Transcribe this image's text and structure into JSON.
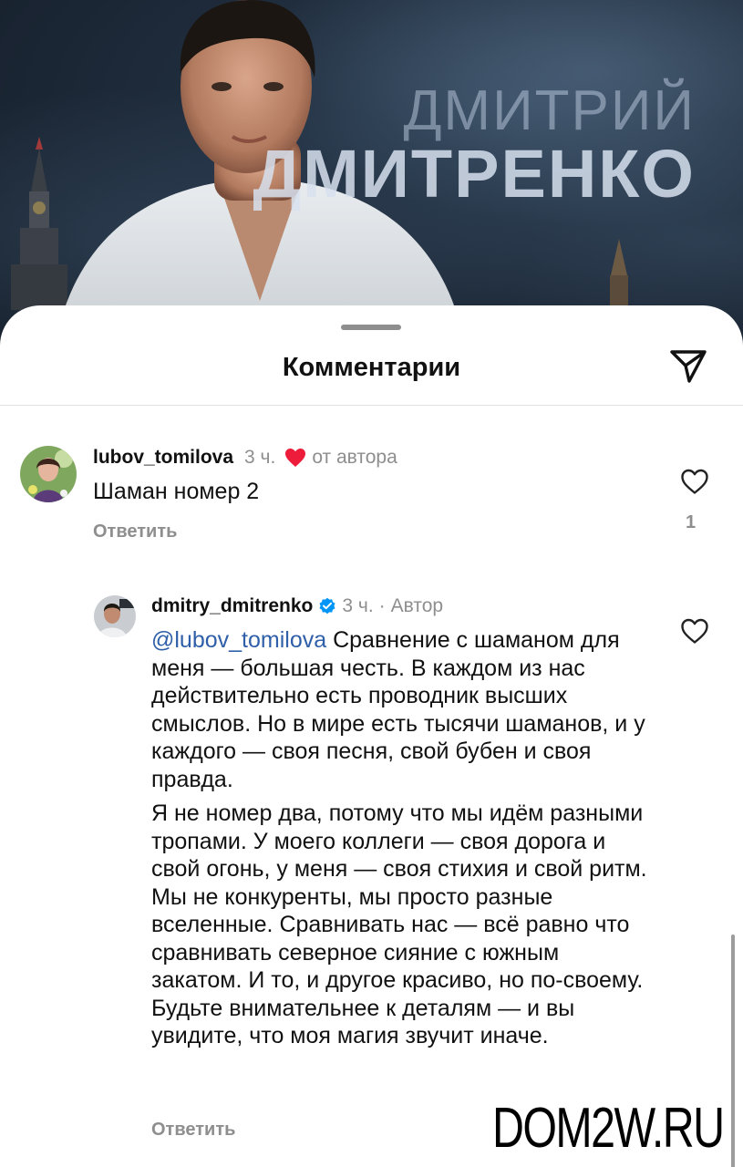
{
  "hero": {
    "title_first": "ДМИТРИЙ",
    "title_last": "ДМИТРЕНКО"
  },
  "sheet": {
    "title": "Комментарии",
    "send_icon": "paper-plane-icon"
  },
  "comments": [
    {
      "username": "lubov_tomilova",
      "time": "3 ч.",
      "author_like": "от автора",
      "text": "Шаман номер 2",
      "reply_label": "Ответить",
      "likes": "1",
      "like_icon": "heart-outline-icon"
    }
  ],
  "reply_comment": {
    "username": "dmitry_dmitrenko",
    "verified_icon": "verified-badge-icon",
    "time": "3 ч.",
    "separator": "·",
    "author_badge": "Автор",
    "mention": "@lubov_tomilova",
    "paragraph1": " Сравнение с шаманом для меня — большая честь. В каждом из нас действительно есть проводник высших смыслов. Но в мире есть тысячи шаманов, и у каждого — своя песня, свой бубен и своя правда.",
    "paragraph2": "Я не номер два, потому что мы идём разными тропами. У моего коллеги — своя дорога и свой огонь, у меня — своя стихия и свой ритм. Мы не конкуренты, мы просто разные вселенные. Сравнивать нас — всё равно что сравнивать северное сияние с южным закатом. И то, и другое красиво, но по-своему. Будьте внимательнее к деталям — и вы увидите, что моя магия звучит иначе.",
    "reply_label": "Ответить",
    "like_icon": "heart-outline-icon"
  },
  "watermark": "DOM2W.RU",
  "colors": {
    "mention": "#2f5fa8",
    "secondary_text": "#8e8e8e",
    "heart_red": "#ed1c3b",
    "verified_blue": "#0095f6"
  }
}
